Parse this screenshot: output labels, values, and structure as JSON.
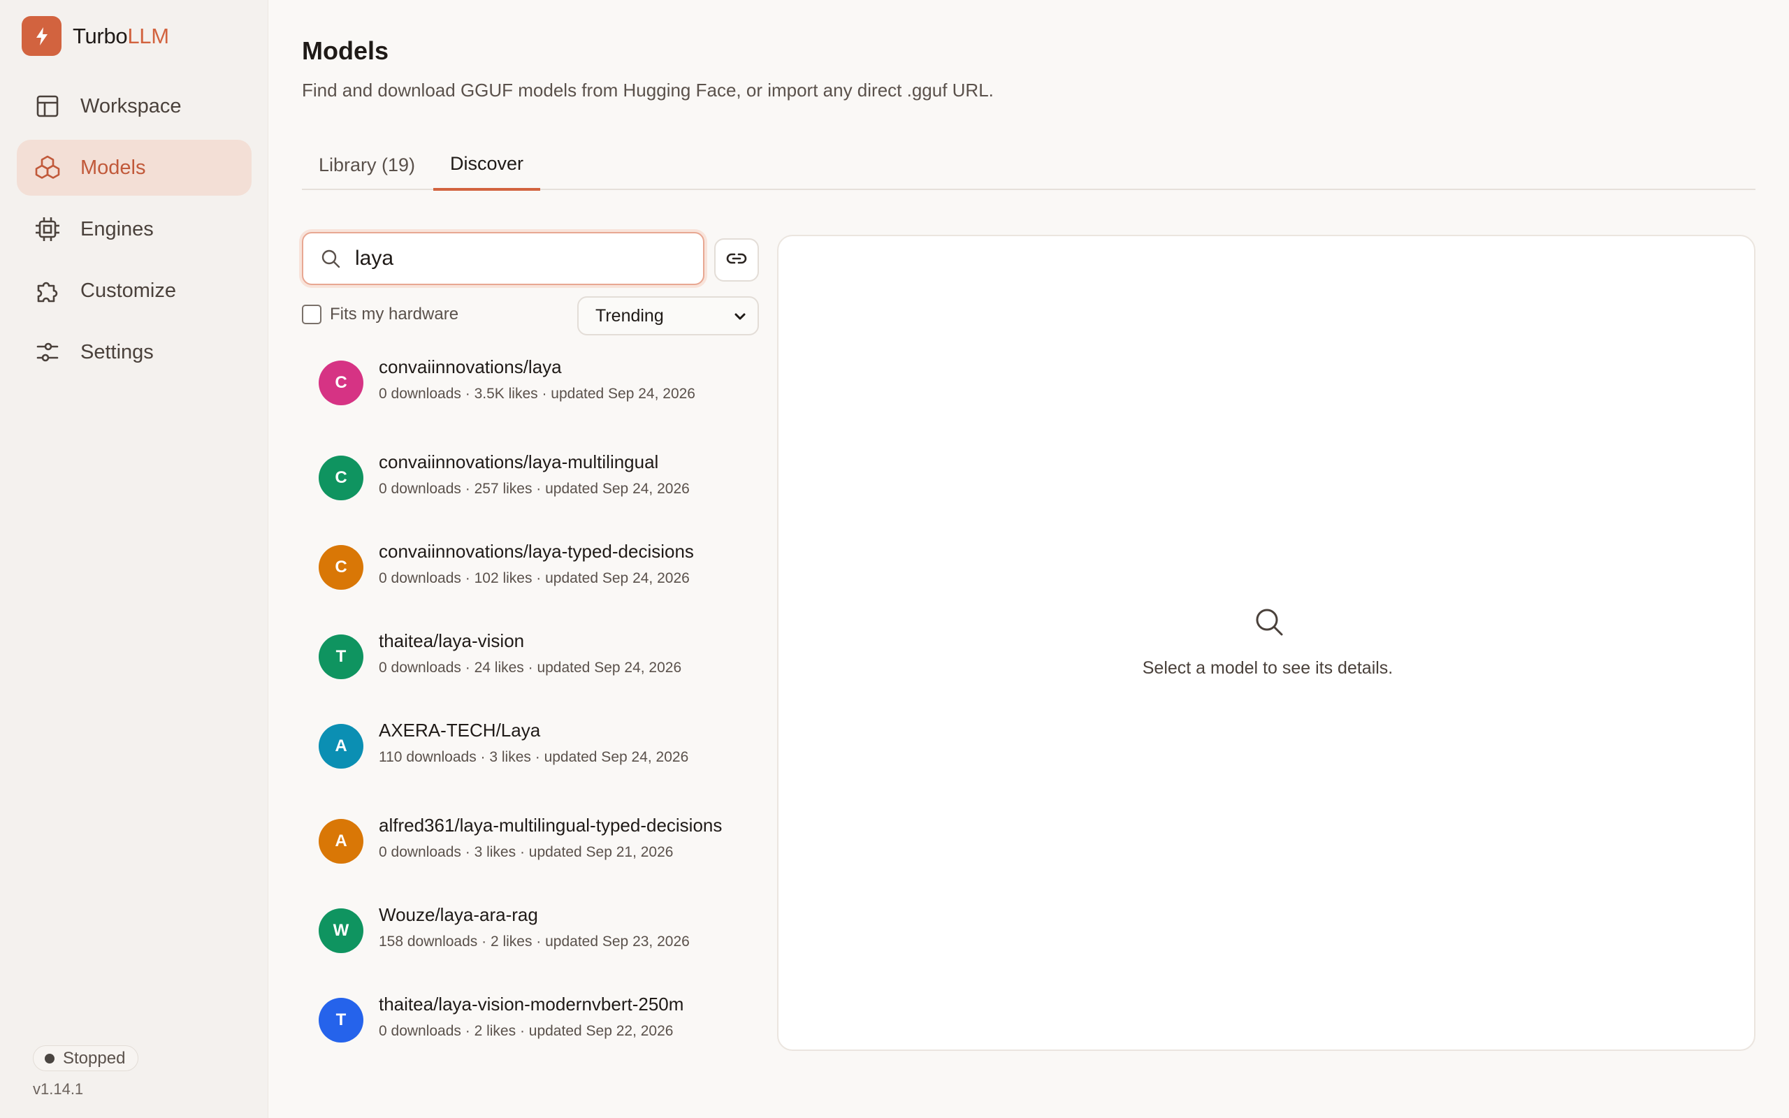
{
  "app": {
    "brand_primary": "Turbo",
    "brand_accent": "LLM",
    "accent_color": "#d2633f"
  },
  "sidebar": {
    "items": [
      {
        "label": "Workspace",
        "icon": "layout-icon",
        "active": false
      },
      {
        "label": "Models",
        "icon": "cubes-icon",
        "active": true
      },
      {
        "label": "Engines",
        "icon": "chip-icon",
        "active": false
      },
      {
        "label": "Customize",
        "icon": "puzzle-icon",
        "active": false
      },
      {
        "label": "Settings",
        "icon": "sliders-icon",
        "active": false
      }
    ],
    "status": "Stopped",
    "version": "v1.14.1"
  },
  "main": {
    "title": "Models",
    "subtitle": "Find and download GGUF models from Hugging Face, or import any direct .gguf URL.",
    "tabs": [
      {
        "label": "Library (19)",
        "active": false
      },
      {
        "label": "Discover",
        "active": true
      }
    ],
    "search": {
      "value": "laya",
      "placeholder": ""
    },
    "fits_hardware_label": "Fits my hardware",
    "fits_hardware_checked": false,
    "sort": {
      "selected": "Trending"
    },
    "results": [
      {
        "initial": "C",
        "color": "#d63384",
        "name": "convaiinnovations/laya",
        "meta": "0 downloads · 3.5K likes · updated Sep 24, 2026"
      },
      {
        "initial": "C",
        "color": "#0f9460",
        "name": "convaiinnovations/laya-multilingual",
        "meta": "0 downloads · 257 likes · updated Sep 24, 2026"
      },
      {
        "initial": "C",
        "color": "#d97706",
        "name": "convaiinnovations/laya-typed-decisions",
        "meta": "0 downloads · 102 likes · updated Sep 24, 2026"
      },
      {
        "initial": "T",
        "color": "#0f9460",
        "name": "thaitea/laya-vision",
        "meta": "0 downloads · 24 likes · updated Sep 24, 2026"
      },
      {
        "initial": "A",
        "color": "#0b8fb3",
        "name": "AXERA-TECH/Laya",
        "meta": "110 downloads · 3 likes · updated Sep 24, 2026"
      },
      {
        "initial": "A",
        "color": "#d97706",
        "name": "alfred361/laya-multilingual-typed-decisions",
        "meta": "0 downloads · 3 likes · updated Sep 21, 2026"
      },
      {
        "initial": "W",
        "color": "#0f9460",
        "name": "Wouze/laya-ara-rag",
        "meta": "158 downloads · 2 likes · updated Sep 23, 2026"
      },
      {
        "initial": "T",
        "color": "#2563eb",
        "name": "thaitea/laya-vision-modernvbert-250m",
        "meta": "0 downloads · 2 likes · updated Sep 22, 2026"
      }
    ],
    "detail": {
      "empty_text": "Select a model to see its details."
    }
  }
}
